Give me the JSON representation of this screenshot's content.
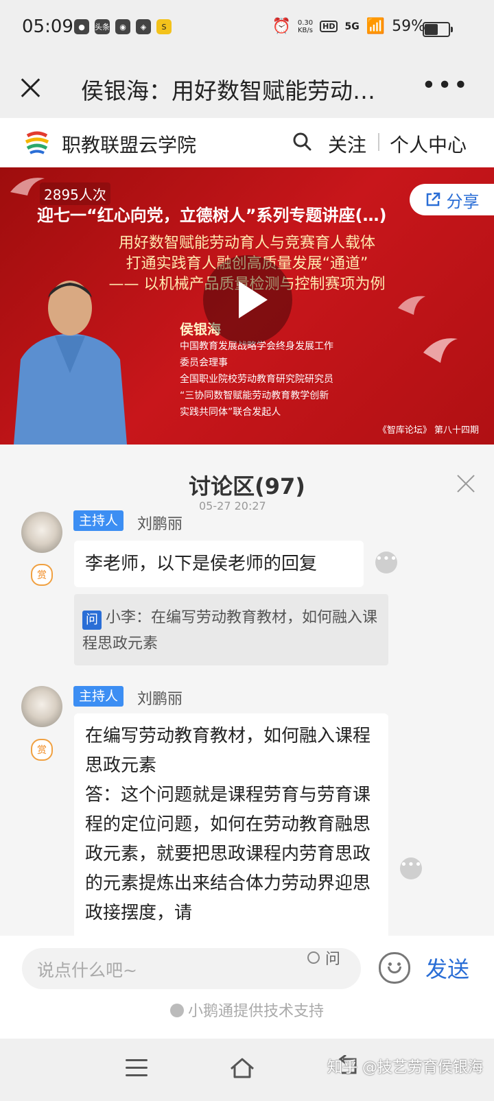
{
  "status_bar": {
    "time": "05:09",
    "app_icons": [
      "头条",
      "S"
    ],
    "net_speed": "0.30",
    "net_unit": "KB/s",
    "hd": "HD",
    "signal": "5G",
    "battery": "59%",
    "battery_level": 0.59
  },
  "title_bar": {
    "title": "侯银海：用好数智赋能劳动…"
  },
  "brand_bar": {
    "name": "职教联盟云学院",
    "follow": "关注",
    "personal_center": "个人中心"
  },
  "video": {
    "views": "2895人次",
    "series_title": "迎七一“红心向党，立德树人”系列专题讲座(…)",
    "lines": [
      "用好数智赋能劳动育人与竞赛育人载体",
      "打通实践育人融创高质量发展“通道”",
      "—— 以机械产品质量检测与控制赛项为例"
    ],
    "speaker_name": "侯银海",
    "speaker_info": [
      "中国教育发展战略学会终身发展工作",
      "委员会理事",
      "全国职业院校劳动教育研究院研究员",
      "“三协同数智赋能劳动教育教学创新",
      "实践共同体”联合发起人"
    ],
    "issue": "《智库论坛》 第八十四期",
    "share": "分享"
  },
  "discussion": {
    "title": "讨论区(97)",
    "cutoff_text": "05-27 20:27",
    "messages": [
      {
        "role_tag": "主持人",
        "user": "刘鹏丽",
        "tip": "赏",
        "text": "李老师，以下是侯老师的回复",
        "quote_icon": "问",
        "quote": "小李：在编写劳动教育教材，如何融入课程思政元素"
      },
      {
        "role_tag": "主持人",
        "user": "刘鹏丽",
        "tip": "赏",
        "paragraphs": [
          "在编写劳动教育教材，如何融入课程思政元素",
          "答：这个问题就是课程劳育与劳育课程的定位问题，如何在劳动教育融思政元素，就要把思政课程内劳育思政的元素提炼出来结合体力劳动界迎思政接摆度，请"
        ]
      }
    ]
  },
  "input_bar": {
    "placeholder": "说点什么吧~",
    "ask_label": "问",
    "send": "发送",
    "support": "小鹅通提供技术支持"
  },
  "watermark": "知乎 @技艺劳育侯银海"
}
